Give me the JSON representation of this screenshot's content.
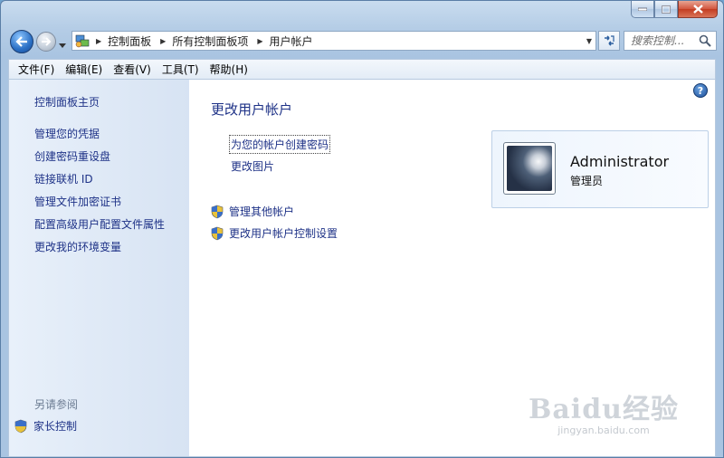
{
  "window": {
    "caption_buttons": [
      "minimize",
      "maximize",
      "close"
    ]
  },
  "address_bar": {
    "breadcrumbs": [
      "控制面板",
      "所有控制面板项",
      "用户帐户"
    ],
    "search_placeholder": "搜索控制...",
    "icon": "control-panel-icon"
  },
  "menu": {
    "items": [
      "文件(F)",
      "编辑(E)",
      "查看(V)",
      "工具(T)",
      "帮助(H)"
    ]
  },
  "sidebar": {
    "items": [
      "控制面板主页",
      "管理您的凭据",
      "创建密码重设盘",
      "链接联机 ID",
      "管理文件加密证书",
      "配置高级用户配置文件属性",
      "更改我的环境变量"
    ],
    "see_also_label": "另请参阅",
    "see_also_items": [
      "家长控制"
    ]
  },
  "main": {
    "title": "更改用户帐户",
    "tasks": [
      {
        "label": "为您的帐户创建密码",
        "shield": false
      },
      {
        "label": "更改图片",
        "shield": false
      },
      {
        "label": "管理其他帐户",
        "shield": true
      },
      {
        "label": "更改用户帐户控制设置",
        "shield": true
      }
    ]
  },
  "user": {
    "name": "Administrator",
    "role": "管理员"
  },
  "watermark": {
    "logo": "Baidu经验",
    "url": "jingyan.baidu.com"
  },
  "colors": {
    "link": "#1e3287",
    "sidebar_bg": "#dce7f5",
    "accent": "#2a6fc4"
  }
}
